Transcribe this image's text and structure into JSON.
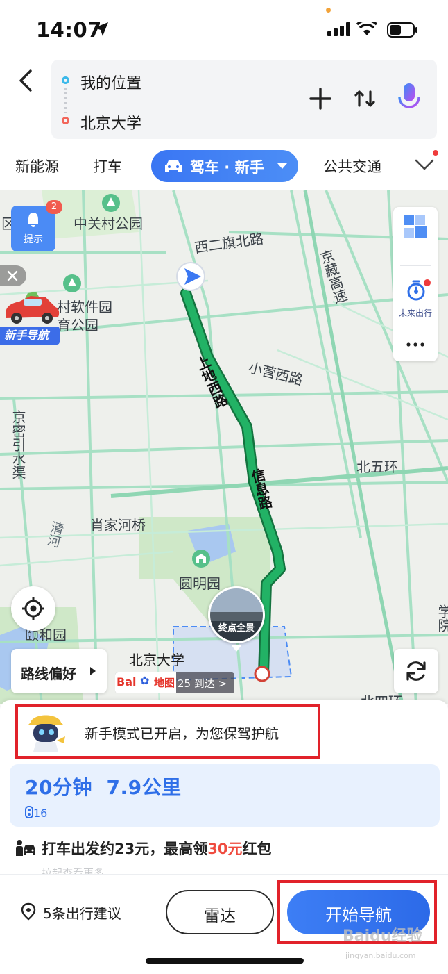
{
  "status_bar": {
    "time": "14:07"
  },
  "header": {
    "origin": "我的位置",
    "destination": "北京大学"
  },
  "tabs": [
    {
      "label": "新能源"
    },
    {
      "label": "打车"
    },
    {
      "label": "驾车 · 新手",
      "active": true
    },
    {
      "label": "公共交通"
    }
  ],
  "map": {
    "tip_button": {
      "label": "提示",
      "badge": "2"
    },
    "newbie_tag": "新手导航",
    "side_panel": {
      "future_travel": "未来出行"
    },
    "labels": {
      "zhongguancun_park": "中关村公园",
      "xierqi_north_road": "西二旗北路",
      "software_park": "村软件园",
      "sports_park": "育公园",
      "jingzang": "京藏高速",
      "xiaoying_west": "小营西路",
      "jingmi_canal": "京密引水渠",
      "shangdi_west": "上地西路",
      "xinxi_road": "信息路",
      "north_5th_ring": "北五环",
      "xiaojiahe_bridge": "肖家河桥",
      "qinghe": "清河",
      "yuanmingyuan": "圆明园",
      "summer_palace": "颐和园",
      "peking_univ": "北京大学",
      "north_4th_ring": "北四环",
      "xue_yuan": "学院",
      "district_fragment": "区"
    },
    "destination_panorama": "终点全景",
    "route_preference": "路线偏好",
    "eta": "25 到达 >",
    "logo_bai": "Bai",
    "logo_ditu": "地图",
    "colors": {
      "route": "#1fa35a",
      "road": "#a7e0c4",
      "park": "#cfe8c8",
      "water": "#a9c8f0"
    }
  },
  "sheet": {
    "mode_banner": "新手模式已开启，为您保驾护航",
    "route_time": "20分钟",
    "route_distance": "7.9公里",
    "traffic_lights": "16",
    "taxi_prefix": "打车出发约23元，最高领",
    "taxi_highlight": "30元",
    "taxi_suffix": "红包",
    "pull_hint": "拉起查看更多"
  },
  "bottom_bar": {
    "suggestions": "5条出行建议",
    "radar": "雷达",
    "start_nav": "开始导航",
    "watermark": "Baidu经验",
    "watermark_url": "jingyan.baidu.com"
  }
}
